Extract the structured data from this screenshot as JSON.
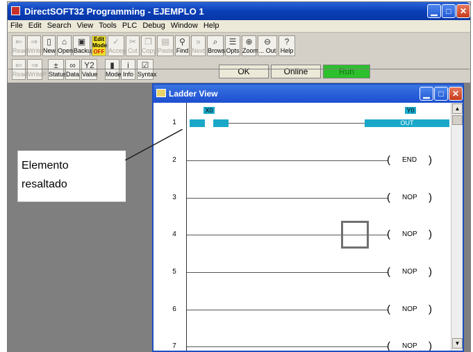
{
  "window": {
    "title": "DirectSOFT32 Programming - EJEMPLO 1"
  },
  "menu": [
    "File",
    "Edit",
    "Search",
    "View",
    "Tools",
    "PLC",
    "Debug",
    "Window",
    "Help"
  ],
  "toolbar1": [
    {
      "label": "Read",
      "icon": "read-icon",
      "disabled": true
    },
    {
      "label": "Write",
      "icon": "write-icon",
      "disabled": true
    },
    {
      "label": "New",
      "icon": "new-file-icon"
    },
    {
      "label": "Open",
      "icon": "open-folder-icon"
    },
    {
      "label": "Backup",
      "icon": "backup-icon"
    },
    {
      "label": "Edit Mode: OFF",
      "icon": "edit-mode-icon"
    },
    {
      "label": "Accept",
      "icon": "accept-icon",
      "disabled": true
    },
    {
      "label": "Cut",
      "icon": "cut-icon",
      "disabled": true
    },
    {
      "label": "Copy",
      "icon": "copy-icon",
      "disabled": true
    },
    {
      "label": "Paste",
      "icon": "paste-icon",
      "disabled": true
    },
    {
      "label": "Find",
      "icon": "binoculars-icon"
    },
    {
      "label": "Next",
      "icon": "next-icon",
      "disabled": true
    },
    {
      "label": "Browse",
      "icon": "browse-icon"
    },
    {
      "label": "Opts",
      "icon": "options-icon"
    },
    {
      "label": "Zoom",
      "icon": "zoom-in-icon"
    },
    {
      "label": "... Out",
      "icon": "zoom-out-icon"
    },
    {
      "label": "Help",
      "icon": "help-icon"
    }
  ],
  "toolbar2": [
    {
      "label": "ReadP",
      "icon": "read-program-icon",
      "disabled": true
    },
    {
      "label": "WriteP",
      "icon": "write-program-icon",
      "disabled": true
    },
    {
      "label": "Status",
      "icon": "status-icon"
    },
    {
      "label": "Data",
      "icon": "data-icon"
    },
    {
      "label": "Value",
      "icon": "value-icon"
    },
    {
      "label": "Mode",
      "icon": "mode-icon"
    },
    {
      "label": "Info",
      "icon": "info-icon"
    },
    {
      "label": "Syntax",
      "icon": "syntax-icon"
    }
  ],
  "edit_mode": {
    "line1": "Edit",
    "line2": "Mode:",
    "state": "OFF"
  },
  "status": {
    "ok": "OK",
    "online": "Online",
    "run": "Run"
  },
  "ladder_view": {
    "title": "Ladder View",
    "rungs": [
      {
        "num": "1",
        "contact": "X0",
        "coil_addr": "Y0",
        "coil": "OUT"
      },
      {
        "num": "2",
        "coil": "END"
      },
      {
        "num": "3",
        "coil": "NOP"
      },
      {
        "num": "4",
        "coil": "NOP"
      },
      {
        "num": "5",
        "coil": "NOP"
      },
      {
        "num": "6",
        "coil": "NOP"
      },
      {
        "num": "7",
        "coil": "NOP"
      }
    ]
  },
  "callout": {
    "line1": "Elemento",
    "line2": "resaltado"
  },
  "colors": {
    "highlight": "#1aa8c8",
    "titlebar": "#0a3fb8",
    "run": "#2cc02c"
  }
}
